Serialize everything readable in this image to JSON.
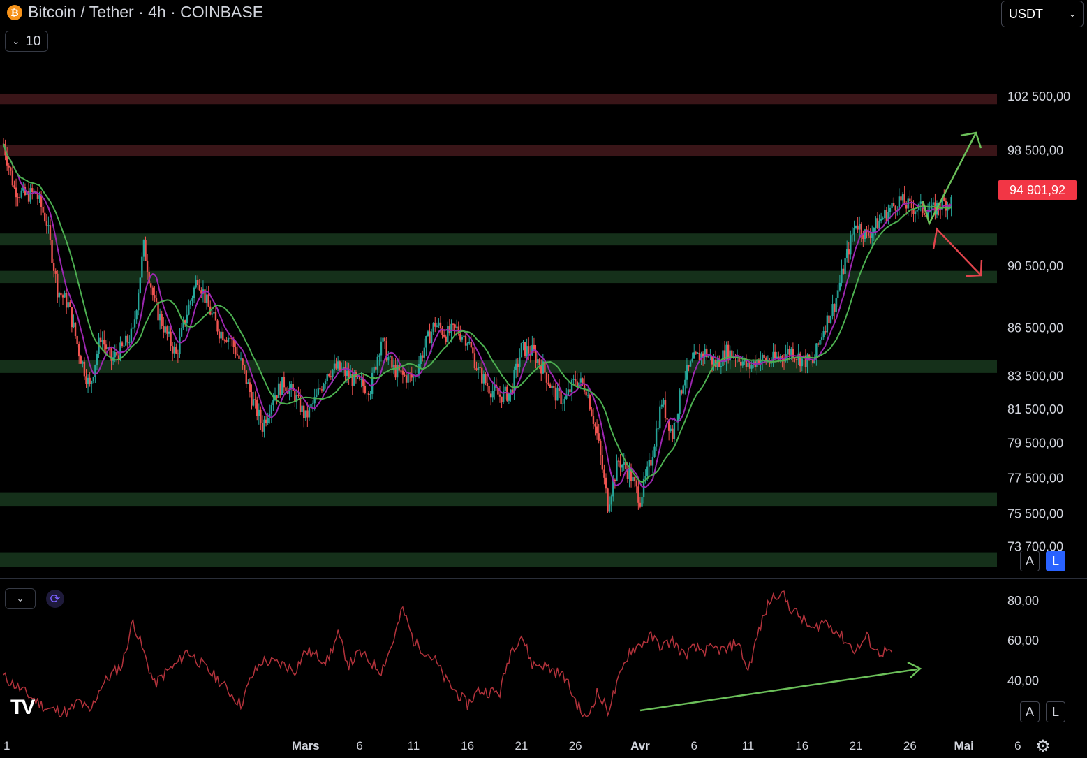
{
  "header": {
    "symbol_icon": "bitcoin-icon",
    "title": "Bitcoin / Tether · 4h · COINBASE",
    "collapse_count": "10",
    "currency": "USDT"
  },
  "price_tag": "94 901,92",
  "scale_buttons": {
    "auto": "A",
    "log": "L"
  },
  "rsi_scale_buttons": {
    "auto": "A",
    "log": "L"
  },
  "chart_data": [
    {
      "type": "candlestick",
      "title": "Bitcoin / Tether · 4h · COINBASE",
      "y_ticks": [
        "102 500,00",
        "98 500,00",
        "90 500,00",
        "86 500,00",
        "83 500,00",
        "81 500,00",
        "79 500,00",
        "77 500,00",
        "75 500,00",
        "73 700,00"
      ],
      "y_tick_values": [
        102500,
        98500,
        90500,
        86500,
        83500,
        81500,
        79500,
        77500,
        75500,
        73700
      ],
      "x_ticks": [
        "1",
        "Mars",
        "6",
        "11",
        "16",
        "21",
        "26",
        "Avr",
        "6",
        "11",
        "16",
        "21",
        "26",
        "Mai",
        "6"
      ],
      "x_tick_days": [
        0,
        28,
        33,
        38,
        43,
        48,
        53,
        59,
        64,
        69,
        74,
        79,
        84,
        89,
        94
      ],
      "x_day_range": [
        0,
        96
      ],
      "ylim": [
        72600,
        104500
      ],
      "last_price": 94901.92,
      "price_path": [
        [
          0,
          99000
        ],
        [
          1,
          95800
        ],
        [
          2,
          95300
        ],
        [
          3,
          95500
        ],
        [
          4,
          93500
        ],
        [
          5,
          89000
        ],
        [
          6,
          88000
        ],
        [
          7,
          85000
        ],
        [
          8,
          82800
        ],
        [
          9,
          86000
        ],
        [
          10,
          84500
        ],
        [
          11,
          85200
        ],
        [
          12,
          86200
        ],
        [
          13,
          91800
        ],
        [
          14,
          88000
        ],
        [
          15,
          86300
        ],
        [
          16,
          84800
        ],
        [
          17,
          87500
        ],
        [
          18,
          89800
        ],
        [
          19,
          87800
        ],
        [
          20,
          86300
        ],
        [
          21,
          85900
        ],
        [
          22,
          84300
        ],
        [
          23,
          82200
        ],
        [
          24,
          80500
        ],
        [
          25,
          82300
        ],
        [
          26,
          83100
        ],
        [
          27,
          82300
        ],
        [
          28,
          81000
        ],
        [
          29,
          82200
        ],
        [
          30,
          83800
        ],
        [
          31,
          84000
        ],
        [
          32,
          83500
        ],
        [
          33,
          83000
        ],
        [
          34,
          82800
        ],
        [
          35,
          85800
        ],
        [
          36,
          84000
        ],
        [
          37,
          83500
        ],
        [
          38,
          83400
        ],
        [
          39,
          85300
        ],
        [
          40,
          86800
        ],
        [
          41,
          86100
        ],
        [
          42,
          86400
        ],
        [
          43,
          85800
        ],
        [
          44,
          83800
        ],
        [
          45,
          82800
        ],
        [
          46,
          82300
        ],
        [
          47,
          82500
        ],
        [
          48,
          85200
        ],
        [
          49,
          85000
        ],
        [
          50,
          84000
        ],
        [
          51,
          82500
        ],
        [
          52,
          82000
        ],
        [
          53,
          83300
        ],
        [
          54,
          82800
        ],
        [
          55,
          80000
        ],
        [
          56,
          76000
        ],
        [
          57,
          78500
        ],
        [
          58,
          77800
        ],
        [
          59,
          76300
        ],
        [
          60,
          78500
        ],
        [
          61,
          82000
        ],
        [
          62,
          80000
        ],
        [
          63,
          83300
        ],
        [
          64,
          84500
        ],
        [
          65,
          85000
        ],
        [
          66,
          84200
        ],
        [
          67,
          85000
        ],
        [
          68,
          84800
        ],
        [
          69,
          84000
        ],
        [
          70,
          84600
        ],
        [
          71,
          84400
        ],
        [
          72,
          84700
        ],
        [
          73,
          85100
        ],
        [
          74,
          84500
        ],
        [
          75,
          84300
        ],
        [
          76,
          86500
        ],
        [
          77,
          88000
        ],
        [
          78,
          90800
        ],
        [
          79,
          93500
        ],
        [
          80,
          92500
        ],
        [
          81,
          93400
        ],
        [
          82,
          94200
        ],
        [
          83,
          95000
        ],
        [
          84,
          94500
        ],
        [
          85,
          94400
        ],
        [
          86,
          94200
        ],
        [
          87,
          94800
        ],
        [
          88,
          94900
        ]
      ],
      "zones": [
        {
          "color": "#3a1518",
          "from": 101900,
          "to": 102700
        },
        {
          "color": "#3a1518",
          "from": 98100,
          "to": 98900
        },
        {
          "color": "#15301a",
          "from": 91900,
          "to": 92700
        },
        {
          "color": "#15301a",
          "from": 89400,
          "to": 90200
        },
        {
          "color": "#15301a",
          "from": 83700,
          "to": 84500
        },
        {
          "color": "#15301a",
          "from": 75900,
          "to": 76700
        },
        {
          "color": "#15301a",
          "from": 72600,
          "to": 73400
        }
      ],
      "colors": {
        "up": "#26a69a",
        "down": "#ef5350",
        "ma_fast": "#9c27b0",
        "ma_slow": "#4caf50",
        "up_arrow": "#6bbf59",
        "down_arrow": "#e0444c"
      }
    },
    {
      "type": "line",
      "y_ticks": [
        "80,00",
        "60,00",
        "40,00"
      ],
      "y_tick_values": [
        80,
        60,
        40
      ],
      "ylim": [
        17,
        87
      ],
      "rsi_path": [
        [
          0,
          42
        ],
        [
          2,
          34
        ],
        [
          4,
          26
        ],
        [
          6,
          24
        ],
        [
          7,
          30
        ],
        [
          8,
          24
        ],
        [
          9,
          37
        ],
        [
          10,
          43
        ],
        [
          11,
          48
        ],
        [
          12,
          70
        ],
        [
          13,
          54
        ],
        [
          14,
          38
        ],
        [
          15,
          44
        ],
        [
          16,
          48
        ],
        [
          17,
          55
        ],
        [
          18,
          50
        ],
        [
          20,
          40
        ],
        [
          22,
          28
        ],
        [
          23,
          42
        ],
        [
          24,
          50
        ],
        [
          26,
          48
        ],
        [
          27,
          45
        ],
        [
          28,
          55
        ],
        [
          30,
          50
        ],
        [
          31,
          63
        ],
        [
          32,
          48
        ],
        [
          33,
          54
        ],
        [
          35,
          45
        ],
        [
          36,
          58
        ],
        [
          37,
          76
        ],
        [
          38,
          60
        ],
        [
          39,
          55
        ],
        [
          40,
          50
        ],
        [
          41,
          40
        ],
        [
          43,
          28
        ],
        [
          44,
          35
        ],
        [
          46,
          34
        ],
        [
          47,
          55
        ],
        [
          48,
          63
        ],
        [
          49,
          48
        ],
        [
          50,
          48
        ],
        [
          51,
          45
        ],
        [
          52,
          42
        ],
        [
          53,
          30
        ],
        [
          54,
          20
        ],
        [
          55,
          34
        ],
        [
          56,
          25
        ],
        [
          57,
          40
        ],
        [
          58,
          55
        ],
        [
          59,
          58
        ],
        [
          60,
          62
        ],
        [
          61,
          57
        ],
        [
          62,
          60
        ],
        [
          63,
          53
        ],
        [
          64,
          56
        ],
        [
          65,
          55
        ],
        [
          66,
          56
        ],
        [
          67,
          55
        ],
        [
          68,
          60
        ],
        [
          69,
          45
        ],
        [
          70,
          65
        ],
        [
          71,
          80
        ],
        [
          72,
          85
        ],
        [
          73,
          76
        ],
        [
          74,
          71
        ],
        [
          75,
          65
        ],
        [
          76,
          70
        ],
        [
          77,
          66
        ],
        [
          78,
          60
        ],
        [
          79,
          55
        ],
        [
          80,
          62
        ],
        [
          81,
          54
        ],
        [
          82,
          55
        ],
        [
          82.5,
          50
        ]
      ],
      "colors": {
        "line": "#b2323b",
        "divergence_arrow": "#6bbf59"
      }
    }
  ]
}
